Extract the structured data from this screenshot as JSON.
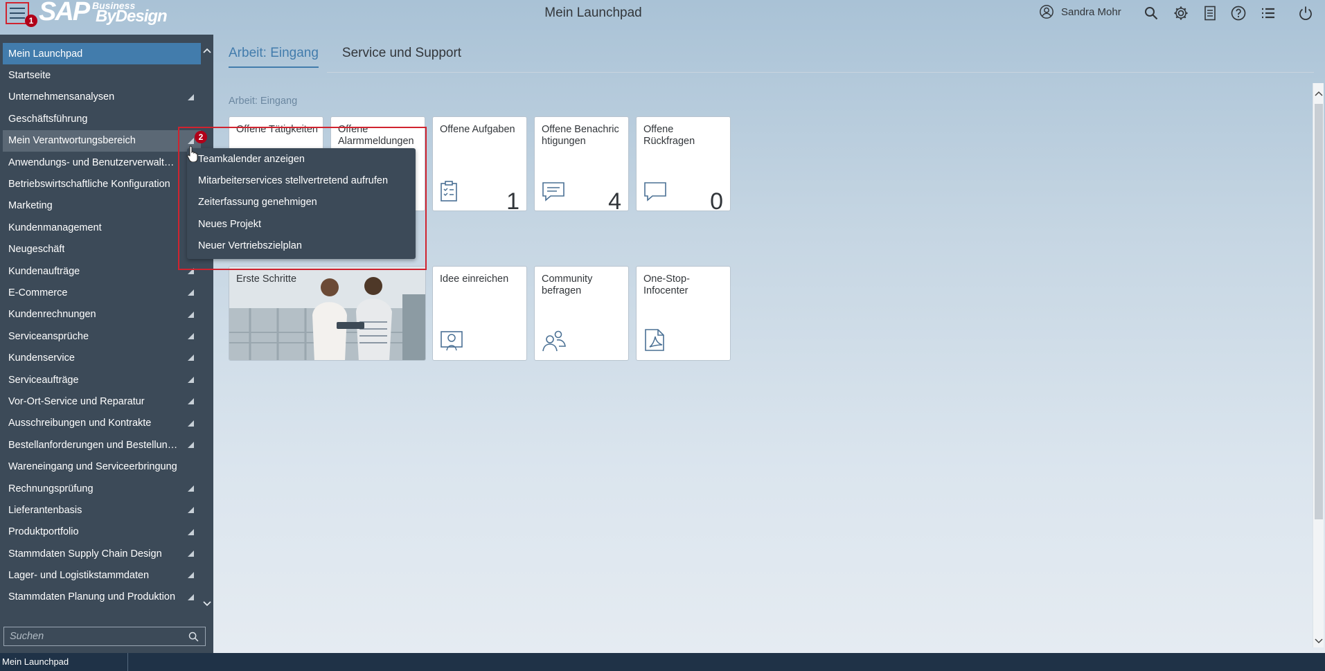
{
  "header": {
    "logo_main": "SAP",
    "logo_business": "Business",
    "logo_product": "ByDesign",
    "title": "Mein Launchpad",
    "user_name": "Sandra Mohr",
    "badge_1": "1",
    "badge_2": "2"
  },
  "sidebar": {
    "items": [
      {
        "label": "Mein Launchpad",
        "arrow": false
      },
      {
        "label": "Startseite",
        "arrow": false
      },
      {
        "label": "Unternehmensanalysen",
        "arrow": true
      },
      {
        "label": "Geschäftsführung",
        "arrow": false
      },
      {
        "label": "Mein Verantwortungsbereich",
        "arrow": true
      },
      {
        "label": "Anwendungs- und Benutzerverwaltung",
        "arrow": false
      },
      {
        "label": "Betriebswirtschaftliche Konfiguration",
        "arrow": false
      },
      {
        "label": "Marketing",
        "arrow": false
      },
      {
        "label": "Kundenmanagement",
        "arrow": false
      },
      {
        "label": "Neugeschäft",
        "arrow": false
      },
      {
        "label": "Kundenaufträge",
        "arrow": true
      },
      {
        "label": "E-Commerce",
        "arrow": true
      },
      {
        "label": "Kundenrechnungen",
        "arrow": true
      },
      {
        "label": "Serviceansprüche",
        "arrow": true
      },
      {
        "label": "Kundenservice",
        "arrow": true
      },
      {
        "label": "Serviceaufträge",
        "arrow": true
      },
      {
        "label": "Vor-Ort-Service und Reparatur",
        "arrow": true
      },
      {
        "label": "Ausschreibungen und Kontrakte",
        "arrow": true
      },
      {
        "label": "Bestellanforderungen und Bestellungen",
        "arrow": true
      },
      {
        "label": "Wareneingang und Serviceerbringung",
        "arrow": false
      },
      {
        "label": "Rechnungsprüfung",
        "arrow": true
      },
      {
        "label": "Lieferantenbasis",
        "arrow": true
      },
      {
        "label": "Produktportfolio",
        "arrow": true
      },
      {
        "label": "Stammdaten Supply Chain Design",
        "arrow": true
      },
      {
        "label": "Lager- und Logistikstammdaten",
        "arrow": true
      },
      {
        "label": "Stammdaten Planung und Produktion",
        "arrow": true
      }
    ],
    "search_placeholder": "Suchen"
  },
  "context_menu": {
    "items": [
      "Teamkalender anzeigen",
      "Mitarbeiterservices stellvertretend aufrufen",
      "Zeiterfassung genehmigen",
      "Neues Projekt",
      "Neuer Vertriebszielplan"
    ]
  },
  "tabs": [
    "Arbeit: Eingang",
    "Service und Support"
  ],
  "section": {
    "label": "Arbeit: Eingang"
  },
  "tiles_row1": [
    {
      "title": "Offene Tätigkeiten",
      "count": ""
    },
    {
      "title": "Offene Alarmmeldungen",
      "count": ""
    },
    {
      "title": "Offene Aufgaben",
      "count": "1",
      "icon": "clipboard-icon"
    },
    {
      "title": "Offene Benachrichtigungen",
      "count": "4",
      "icon": "chat-icon"
    },
    {
      "title": "Offene Rückfragen",
      "count": "0",
      "icon": "speech-bubble-icon"
    }
  ],
  "tiles_row2": [
    {
      "title": "Erste Schritte",
      "icon": "photo"
    },
    {
      "title": "Idee einreichen",
      "icon": "idea-icon"
    },
    {
      "title": "Community befragen",
      "icon": "community-icon"
    },
    {
      "title": "One-Stop-Infocenter",
      "icon": "pdf-icon"
    }
  ],
  "statusbar": {
    "tab": "Mein Launchpad"
  },
  "colors": {
    "accent": "#427cac",
    "sidebar": "#3c4a58",
    "highlight": "#d0232f",
    "statusbar": "#1f3247"
  }
}
